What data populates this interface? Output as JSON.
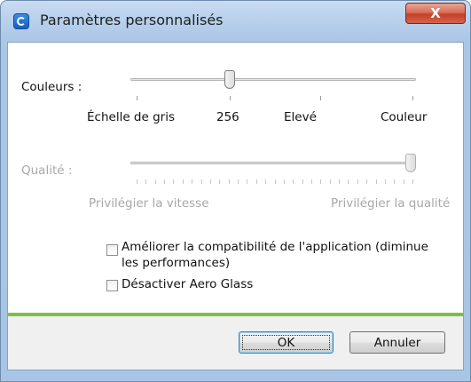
{
  "window": {
    "title": "Paramètres personnalisés",
    "close_label": "X"
  },
  "colors_slider": {
    "label": "Couleurs :",
    "tick_labels": [
      "Échelle de gris",
      "256",
      "Elevé",
      "Couleur"
    ],
    "selected_index": 1,
    "steps": 4
  },
  "quality_slider": {
    "label": "Qualité :",
    "enabled": false,
    "min_label": "Privilégier la vitesse",
    "max_label": "Privilégier la qualité",
    "value_fraction": 1.0
  },
  "options": {
    "compat_label_line1": "Améliorer la compatibilité de l'application (diminue",
    "compat_label_line2": "les performances)",
    "compat_checked": false,
    "aero_label": "Désactiver Aero Glass",
    "aero_checked": false
  },
  "buttons": {
    "ok_label": "OK",
    "cancel_label": "Annuler"
  },
  "colors": {
    "accent_green": "#7ac143",
    "close_red": "#c4402a",
    "frame_blue": "#aac6e6"
  }
}
